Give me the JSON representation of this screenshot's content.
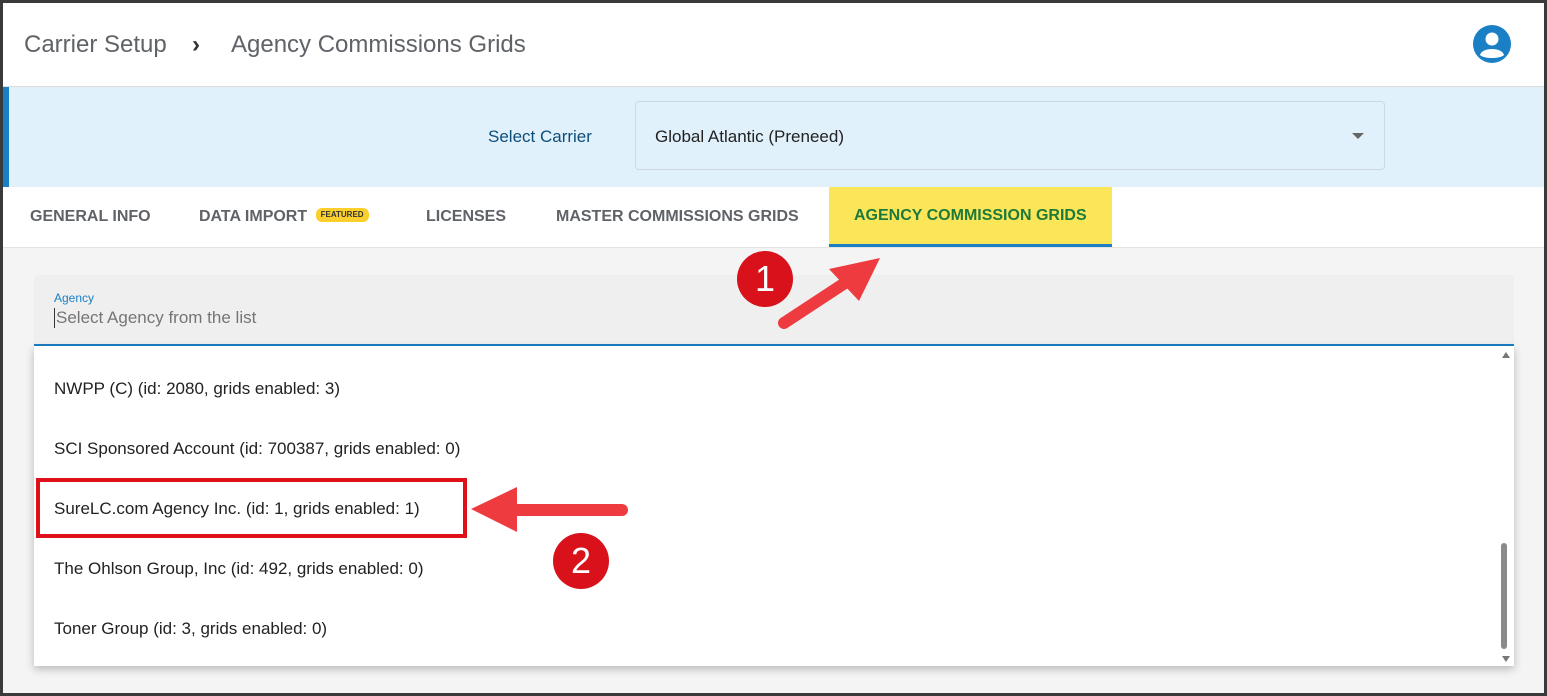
{
  "header": {
    "breadcrumb_root": "Carrier Setup",
    "breadcrumb_separator": "›",
    "breadcrumb_current": "Agency Commissions Grids",
    "avatar_icon": "account-circle-icon"
  },
  "carrier": {
    "label": "Select Carrier",
    "selected": "Global Atlantic (Preneed)"
  },
  "tabs": [
    {
      "label": "GENERAL INFO",
      "active": false
    },
    {
      "label": "DATA IMPORT",
      "badge": "FEATURED",
      "active": false
    },
    {
      "label": "LICENSES",
      "active": false
    },
    {
      "label": "MASTER COMMISSIONS GRIDS",
      "active": false
    },
    {
      "label": "AGENCY COMMISSION GRIDS",
      "active": true
    }
  ],
  "agency": {
    "label": "Agency",
    "placeholder": "Select Agency from the list",
    "options": [
      "NWPP (C) (id: 2080, grids enabled: 3)",
      "SCI Sponsored Account (id: 700387, grids enabled: 0)",
      "SureLC.com Agency Inc. (id: 1, grids enabled: 1)",
      "The Ohlson Group, Inc (id: 492, grids enabled: 0)",
      "Toner Group (id: 3, grids enabled: 0)"
    ],
    "highlighted_option": "SureLC.com Agency Inc. (id: 1, grids enabled: 1)"
  },
  "annotations": {
    "marker_1": "1",
    "marker_2": "2"
  },
  "colors": {
    "accent": "#1a7fc4",
    "active_tab_bg": "#fbe65a",
    "active_tab_text": "#1d7a3a",
    "annotation_red": "#e0101a",
    "carrier_band": "#e1f1fc"
  }
}
